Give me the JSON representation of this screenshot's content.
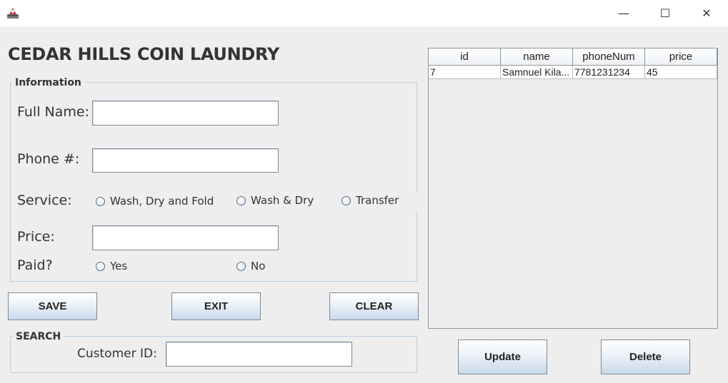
{
  "window": {
    "minimize_glyph": "—",
    "maximize_glyph": "☐",
    "close_glyph": "✕"
  },
  "app": {
    "title": "CEDAR HILLS COIN LAUNDRY"
  },
  "information": {
    "group_title": "Information",
    "full_name_label": "Full Name:",
    "full_name_value": "",
    "phone_label": "Phone #:",
    "phone_value": "",
    "service_label": "Service:",
    "service_options": [
      "Wash, Dry and Fold",
      "Wash & Dry",
      "Transfer"
    ],
    "price_label": "Price:",
    "price_value": "",
    "paid_label": "Paid?",
    "paid_options": [
      "Yes",
      "No"
    ]
  },
  "actions": {
    "save": "SAVE",
    "exit": "EXIT",
    "clear": "CLEAR"
  },
  "search": {
    "group_title": "SEARCH",
    "customer_id_label": "Customer ID:",
    "customer_id_value": ""
  },
  "table": {
    "columns": [
      "id",
      "name",
      "phoneNum",
      "price"
    ],
    "rows": [
      [
        "7",
        "Samnuel Kila...",
        "7781231234",
        "45"
      ]
    ]
  },
  "table_actions": {
    "update": "Update",
    "delete": "Delete"
  }
}
